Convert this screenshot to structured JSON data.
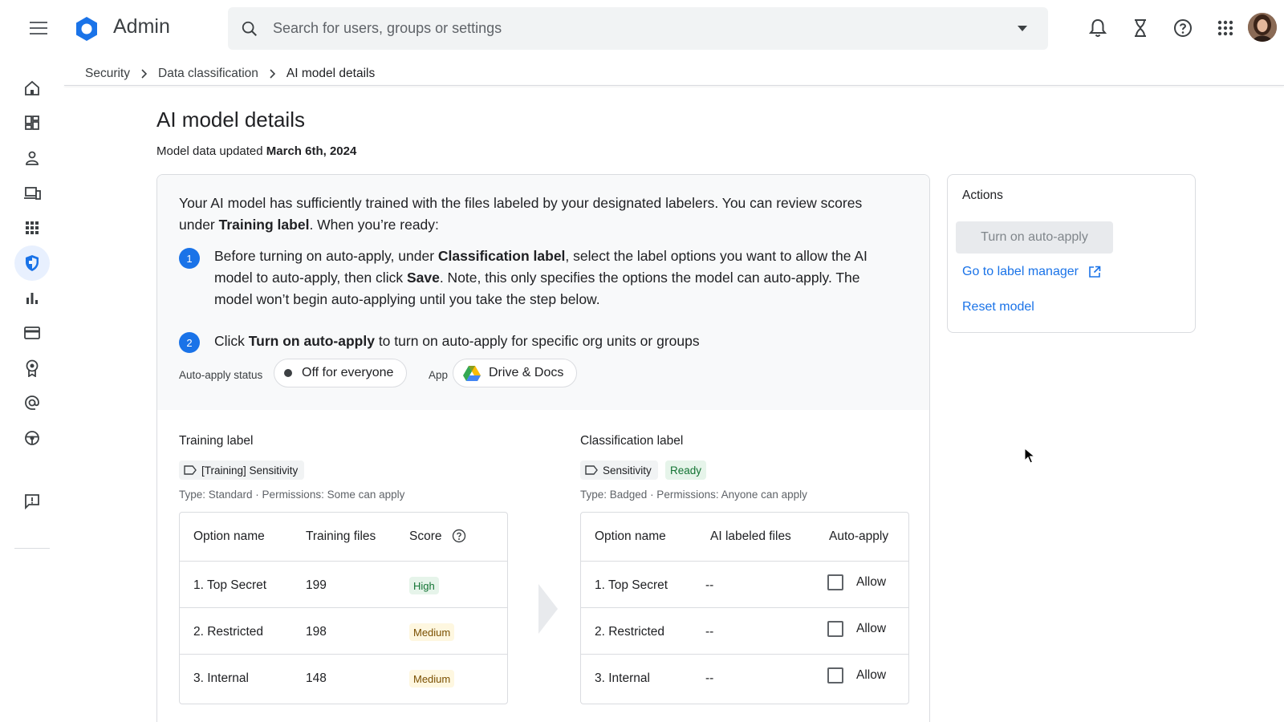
{
  "header": {
    "app_name": "Admin",
    "search_placeholder": "Search for users, groups or settings"
  },
  "breadcrumb": [
    "Security",
    "Data classification",
    "AI model details"
  ],
  "page": {
    "title": "AI model details",
    "updated_prefix": "Model data updated ",
    "updated_date": "March 6th, 2024"
  },
  "info": {
    "intro_1": "Your AI model has sufficiently trained with the files labeled by your designated labelers. You can review scores under ",
    "intro_bold": "Training label",
    "intro_2": ". When you’re ready:",
    "step1_num": "1",
    "step1_a": "Before turning on auto-apply, under ",
    "step1_bold1": "Classification label",
    "step1_b": ", select the label options you want to allow the AI model to auto-apply, then click ",
    "step1_bold2": "Save",
    "step1_c": ". Note, this only specifies the options the model can auto-apply. The model won’t begin auto-applying until you take the step below.",
    "step2_num": "2",
    "step2_a": "Click ",
    "step2_bold": "Turn on auto-apply",
    "step2_b": " to turn on auto-apply for specific org units or groups",
    "status_label": "Auto-apply status",
    "status_value": "Off for everyone",
    "app_label": "App",
    "app_value": "Drive & Docs"
  },
  "training": {
    "title": "Training label",
    "label": "[Training] Sensitivity",
    "type_line": "Type: Standard · Permissions: Some can apply",
    "headers": [
      "Option name",
      "Training files",
      "Score"
    ],
    "rows": [
      {
        "name": "1. Top Secret",
        "files": "199",
        "score": "High"
      },
      {
        "name": "2. Restricted",
        "files": "198",
        "score": "Medium"
      },
      {
        "name": "3. Internal",
        "files": "148",
        "score": "Medium"
      }
    ]
  },
  "classification": {
    "title": "Classification label",
    "label": "Sensitivity",
    "status": "Ready",
    "type_line": "Type: Badged · Permissions: Anyone can apply",
    "headers": [
      "Option name",
      "AI labeled files",
      "Auto-apply"
    ],
    "rows": [
      {
        "name": "1. Top Secret",
        "files": "--",
        "allow": "Allow"
      },
      {
        "name": "2. Restricted",
        "files": "--",
        "allow": "Allow"
      },
      {
        "name": "3. Internal",
        "files": "--",
        "allow": "Allow"
      }
    ]
  },
  "actions": {
    "title": "Actions",
    "auto_apply": "Turn on auto-apply",
    "label_manager": "Go to label manager",
    "reset": "Reset model"
  },
  "colors": {
    "accent": "#1a73e8",
    "high": "#137333",
    "medium": "#7a4f00"
  }
}
